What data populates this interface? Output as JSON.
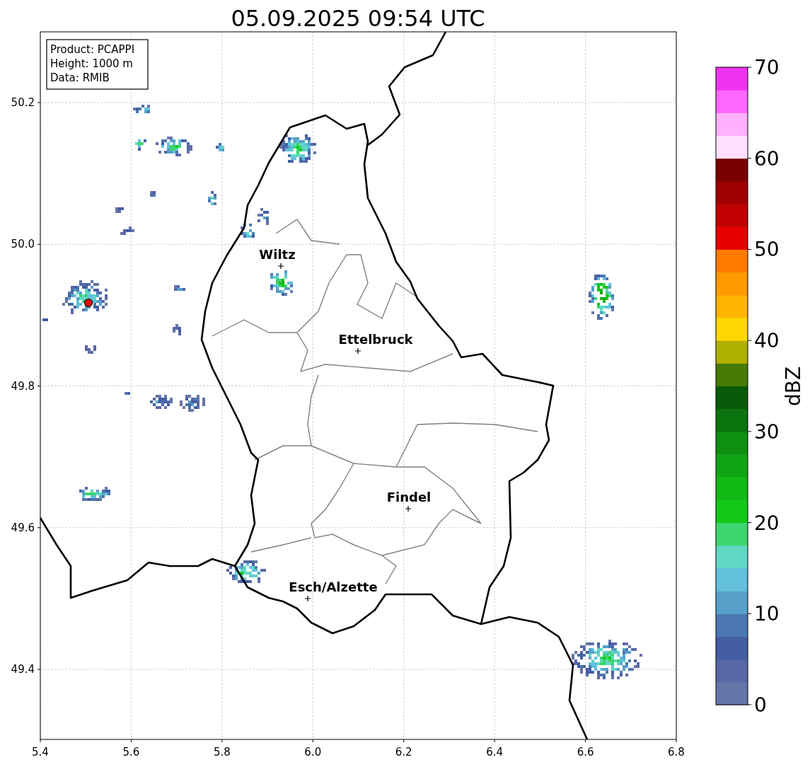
{
  "title": "05.09.2025 09:54 UTC",
  "info_box": [
    "Product: PCAPPI",
    "Height: 1000 m",
    "Data: RMIB"
  ],
  "x_ticks": [
    "5.4",
    "5.6",
    "5.8",
    "6.0",
    "6.2",
    "6.4",
    "6.6",
    "6.8"
  ],
  "y_ticks": [
    "50.2",
    "50.0",
    "49.8",
    "49.6",
    "49.4"
  ],
  "cities": [
    {
      "name": "Wiltz"
    },
    {
      "name": "Ettelbruck"
    },
    {
      "name": "Findel"
    },
    {
      "name": "Esch/Alzette"
    }
  ],
  "colorbar": {
    "label": "dBZ",
    "ticks": [
      "70",
      "60",
      "50",
      "40",
      "30",
      "20",
      "10",
      "0"
    ]
  }
}
